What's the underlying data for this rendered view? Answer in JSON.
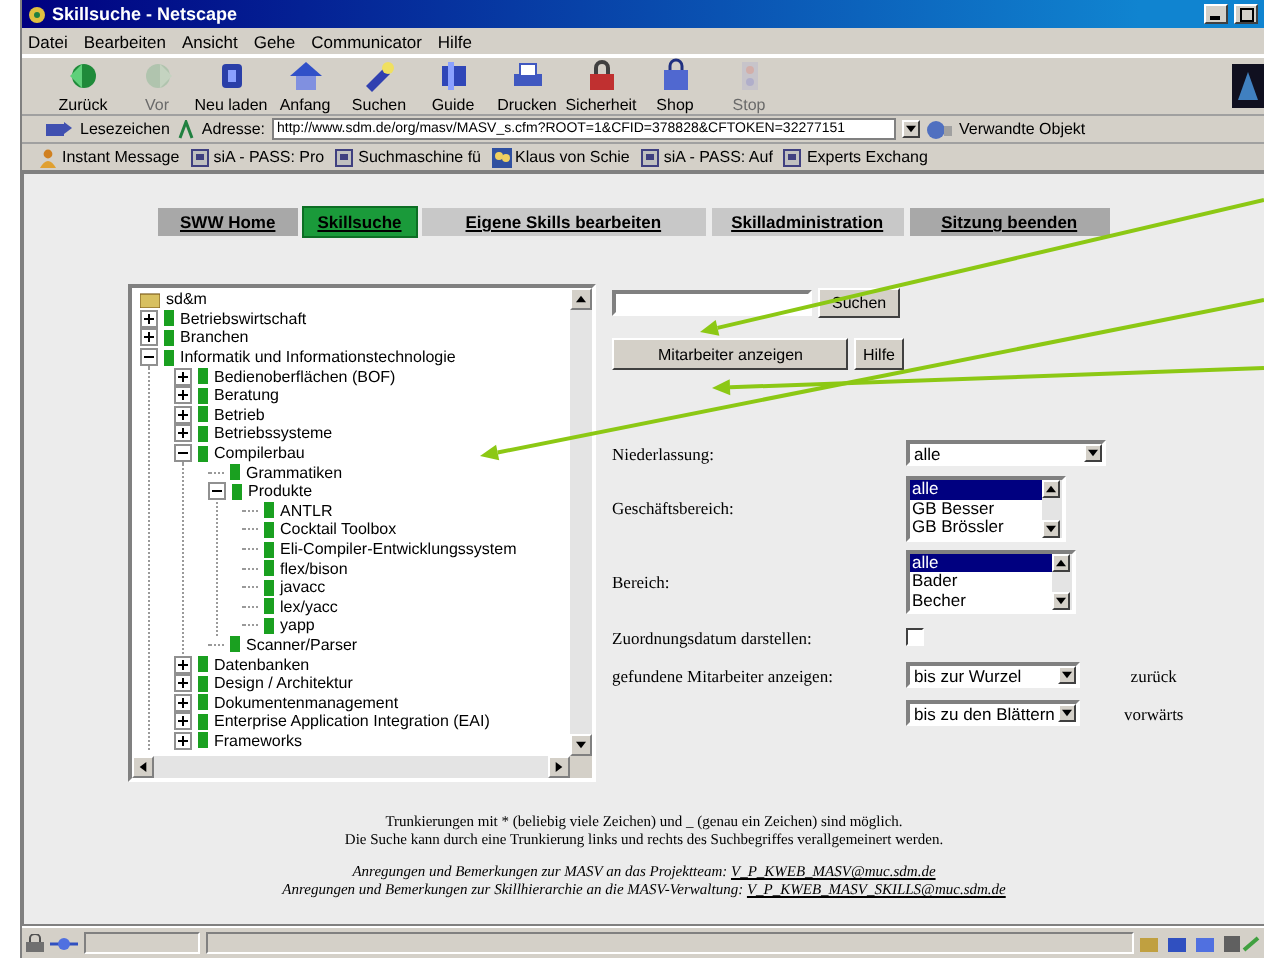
{
  "window": {
    "title": "Skillsuche - Netscape"
  },
  "menu": [
    "Datei",
    "Bearbeiten",
    "Ansicht",
    "Gehe",
    "Communicator",
    "Hilfe"
  ],
  "toolbar": [
    {
      "label": "Zurück",
      "kind": "back",
      "disabled": false
    },
    {
      "label": "Vor",
      "kind": "forward",
      "disabled": true
    },
    {
      "label": "Neu laden",
      "kind": "reload",
      "disabled": false
    },
    {
      "label": "Anfang",
      "kind": "home",
      "disabled": false
    },
    {
      "label": "Suchen",
      "kind": "search",
      "disabled": false
    },
    {
      "label": "Guide",
      "kind": "guide",
      "disabled": false
    },
    {
      "label": "Drucken",
      "kind": "print",
      "disabled": false
    },
    {
      "label": "Sicherheit",
      "kind": "security",
      "disabled": false
    },
    {
      "label": "Shop",
      "kind": "shop",
      "disabled": false
    },
    {
      "label": "Stop",
      "kind": "stop",
      "disabled": true
    }
  ],
  "location": {
    "bookmarks": "Lesezeichen",
    "label": "Adresse:",
    "url": "http://www.sdm.de/org/masv/MASV_s.cfm?ROOT=1&CFID=378828&CFTOKEN=32277151",
    "related": "Verwandte Objekt"
  },
  "personal_toolbar": [
    {
      "label": "Instant Message",
      "kind": "person"
    },
    {
      "label": "siA - PASS: Pro",
      "kind": "bookmark"
    },
    {
      "label": "Suchmaschine fü",
      "kind": "bookmark"
    },
    {
      "label": "Klaus von Schie",
      "kind": "people"
    },
    {
      "label": "siA - PASS: Auf",
      "kind": "bookmark"
    },
    {
      "label": "Experts Exchang",
      "kind": "bookmark"
    }
  ],
  "nav_tabs": [
    {
      "label": "SWW Home",
      "selected": false
    },
    {
      "label": "Skillsuche",
      "selected": true
    },
    {
      "label": "Eigene Skills bearbeiten",
      "selected": false
    },
    {
      "label": "Skilladministration",
      "selected": false
    },
    {
      "label": "Sitzung beenden",
      "selected": false
    }
  ],
  "tree": {
    "label": "sd&m",
    "children": [
      {
        "label": "Betriebswirtschaft",
        "expanded": false
      },
      {
        "label": "Branchen",
        "expanded": false
      },
      {
        "label": "Informatik und Informationstechnologie",
        "expanded": true,
        "children": [
          {
            "label": "Bedienoberflächen (BOF)",
            "expanded": false
          },
          {
            "label": "Beratung",
            "expanded": false
          },
          {
            "label": "Betrieb",
            "expanded": false
          },
          {
            "label": "Betriebssysteme",
            "expanded": false
          },
          {
            "label": "Compilerbau",
            "expanded": true,
            "children": [
              {
                "label": "Grammatiken"
              },
              {
                "label": "Produkte",
                "expanded": true,
                "children": [
                  {
                    "label": "ANTLR"
                  },
                  {
                    "label": "Cocktail Toolbox"
                  },
                  {
                    "label": "Eli-Compiler-Entwicklungssystem"
                  },
                  {
                    "label": "flex/bison"
                  },
                  {
                    "label": "javacc"
                  },
                  {
                    "label": "lex/yacc"
                  },
                  {
                    "label": "yapp"
                  }
                ]
              },
              {
                "label": "Scanner/Parser"
              }
            ]
          },
          {
            "label": "Datenbanken",
            "expanded": false
          },
          {
            "label": "Design / Architektur",
            "expanded": false
          },
          {
            "label": "Dokumentenmanagement",
            "expanded": false
          },
          {
            "label": "Enterprise Application Integration (EAI)",
            "expanded": false
          },
          {
            "label": "Frameworks",
            "expanded": false
          }
        ]
      }
    ]
  },
  "search_button": "Suchen",
  "show_button": "Mitarbeiter anzeigen",
  "help_button": "Hilfe",
  "filters": [
    {
      "kind": "dropdown",
      "label": "Niederlassung:",
      "value": "alle"
    },
    {
      "kind": "listbox",
      "label": "Geschäftsbereich:",
      "options": [
        {
          "label": "alle",
          "selected": true
        },
        {
          "label": "GB Besser",
          "selected": false
        },
        {
          "label": "GB Brössler",
          "selected": false
        }
      ]
    },
    {
      "kind": "listbox",
      "label": "Bereich:",
      "options": [
        {
          "label": "alle",
          "selected": true
        },
        {
          "label": "Bader",
          "selected": false
        },
        {
          "label": "Becher",
          "selected": false
        }
      ]
    },
    {
      "kind": "checkbox",
      "label": "Zuordnungsdatum darstellen:",
      "checked": false
    },
    {
      "kind": "dropdown",
      "label": "gefundene Mitarbeiter anzeigen:",
      "value": "bis zur Wurzel",
      "note": "zurück"
    },
    {
      "kind": "dropdown",
      "value": "bis zu den Blättern",
      "note": "vorwärts"
    }
  ],
  "footer": {
    "hints": [
      "Trunkierungen mit * (beliebig viele Zeichen) und _ (genau ein Zeichen) sind möglich.",
      "Die Suche kann durch eine Trunkierung links und rechts des Suchbegriffes verallgemeinert werden."
    ],
    "contacts": [
      {
        "text": "Anregungen und Bemerkungen zur MASV an das Projektteam:",
        "link": "V_P_KWEB_MASV@muc.sdm.de"
      },
      {
        "text": "Anregungen und Bemerkungen zur Skillhierarchie an die MASV-Verwaltung:",
        "link": "V_P_KWEB_MASV_SKILLS@muc.sdm.de"
      }
    ]
  }
}
